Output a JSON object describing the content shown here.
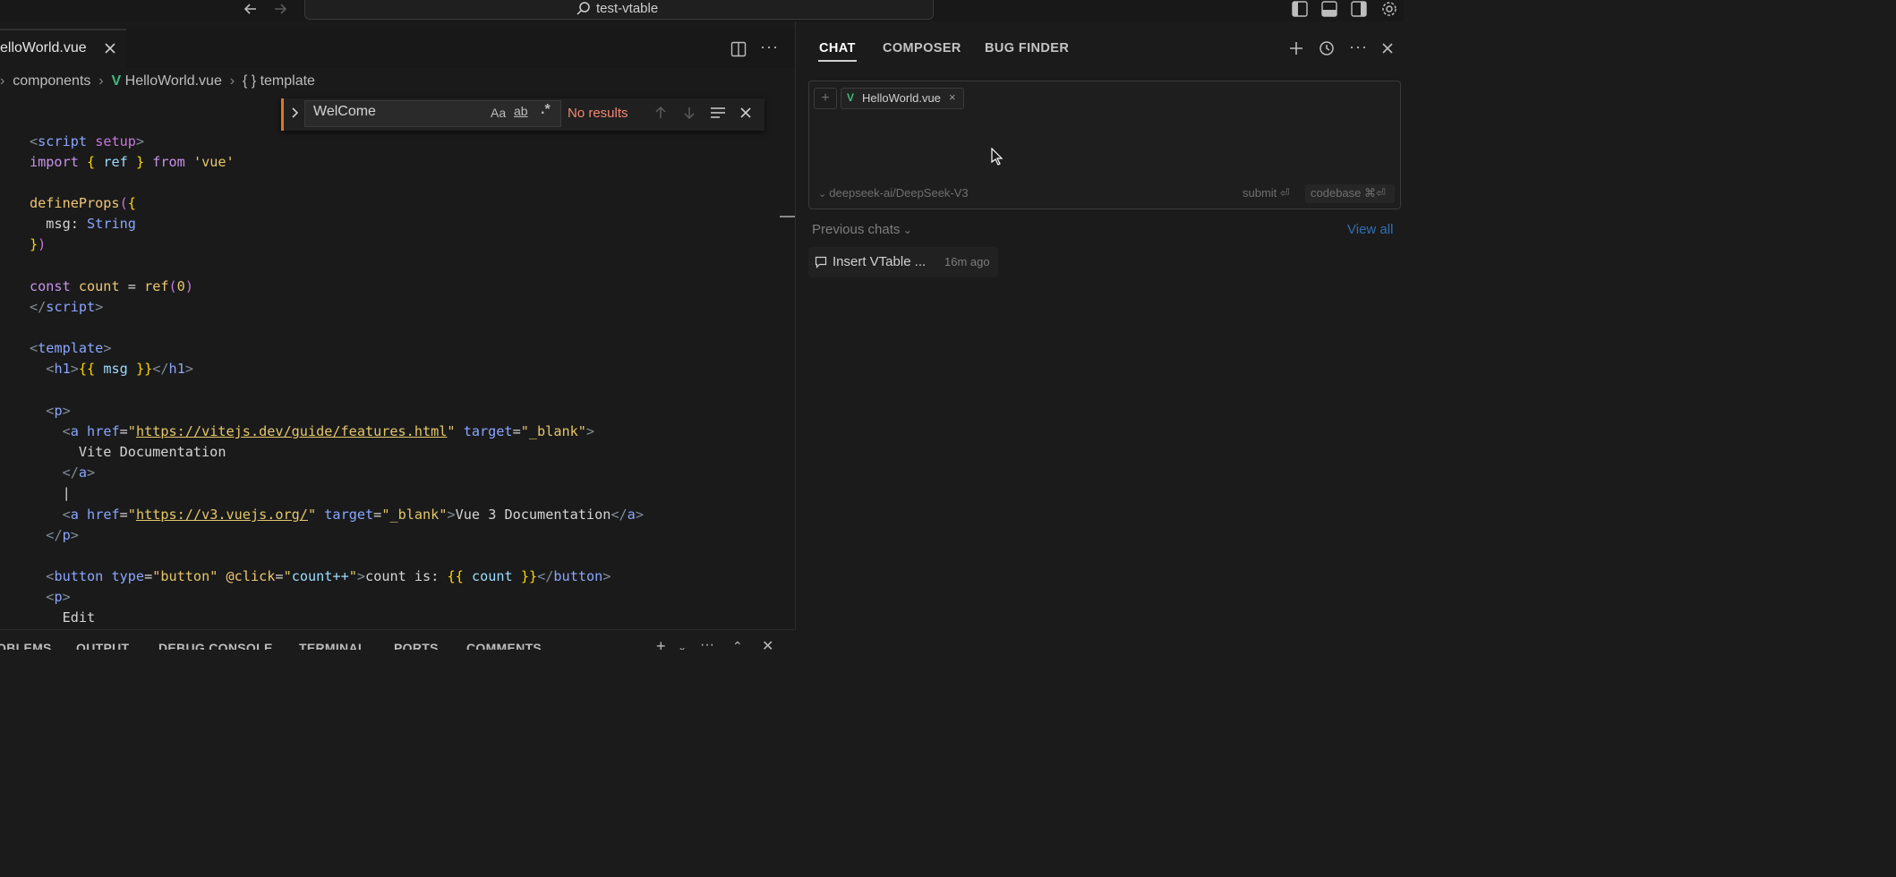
{
  "titlebar": {
    "project": "test-vtable"
  },
  "editor": {
    "tab_label": "elloWorld.vue",
    "breadcrumbs": {
      "part1": "components",
      "part2": "HelloWorld.vue",
      "part3": "{ } template"
    },
    "find": {
      "query": "WelCome",
      "match_case_label": "Aa",
      "whole_word_label": "ab",
      "regex_label": ".*",
      "status": "No results"
    }
  },
  "panel": {
    "tabs": [
      "OBLEMS",
      "OUTPUT",
      "DEBUG CONSOLE",
      "TERMINAL",
      "PORTS",
      "COMMENTS"
    ]
  },
  "chat": {
    "tabs": [
      "CHAT",
      "COMPOSER",
      "BUG FINDER"
    ],
    "context_file": "HelloWorld.vue",
    "model": "deepseek-ai/DeepSeek-V3",
    "submit_label": "submit ⏎",
    "codebase_label": "codebase ⌘⏎",
    "previous_chats_label": "Previous chats",
    "view_all_label": "View all",
    "history": [
      {
        "title": "Insert VTable ...",
        "time": "16m ago"
      }
    ]
  },
  "colors": {
    "accent_orange": "#d97a2b",
    "vue_green": "#41b883",
    "link_blue": "#2f6fb3",
    "error_red": "#f48771"
  }
}
